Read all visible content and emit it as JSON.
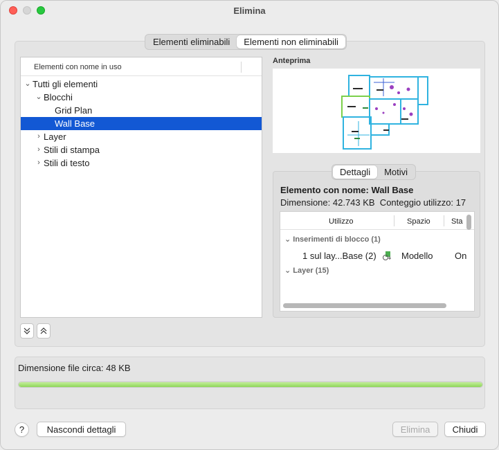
{
  "window": {
    "title": "Elimina"
  },
  "main_tabs": [
    {
      "label": "Elementi eliminabili",
      "active": false
    },
    {
      "label": "Elementi non eliminabili",
      "active": true
    }
  ],
  "tree": {
    "header": "Elementi con nome in uso",
    "items": [
      {
        "label": "Tutti gli elementi",
        "level": 0,
        "expanded": true
      },
      {
        "label": "Blocchi",
        "level": 1,
        "expanded": true
      },
      {
        "label": "Grid Plan",
        "level": 2
      },
      {
        "label": "Wall Base",
        "level": 2,
        "selected": true
      },
      {
        "label": "Layer",
        "level": 1,
        "expanded": false
      },
      {
        "label": "Stili di stampa",
        "level": 1,
        "expanded": false
      },
      {
        "label": "Stili di testo",
        "level": 1,
        "expanded": false
      }
    ]
  },
  "preview": {
    "label": "Anteprima"
  },
  "details": {
    "tabs": [
      {
        "label": "Dettagli",
        "active": true
      },
      {
        "label": "Motivi",
        "active": false
      }
    ],
    "element_name": "Elemento con nome: Wall Base",
    "info": "Dimensione: 42.743 KB  Conteggio utilizzo: 17",
    "columns": [
      "Utilizzo",
      "Spazio",
      "Sta"
    ],
    "groups": [
      {
        "label": "Inserimenti di blocco (1)"
      },
      {
        "label": "Layer (15)"
      }
    ],
    "row": {
      "usage": "1 sul lay...Base (2)",
      "space": "Modello",
      "state": "On"
    }
  },
  "file_size": "Dimensione file circa: 48 KB",
  "progress": {
    "fraction": 1.0
  },
  "buttons": {
    "help": "?",
    "toggle_details": "Nascondi dettagli",
    "delete": "Elimina",
    "close": "Chiudi"
  },
  "colors": {
    "selection": "#1258d4",
    "progress": "#8fd65a"
  }
}
